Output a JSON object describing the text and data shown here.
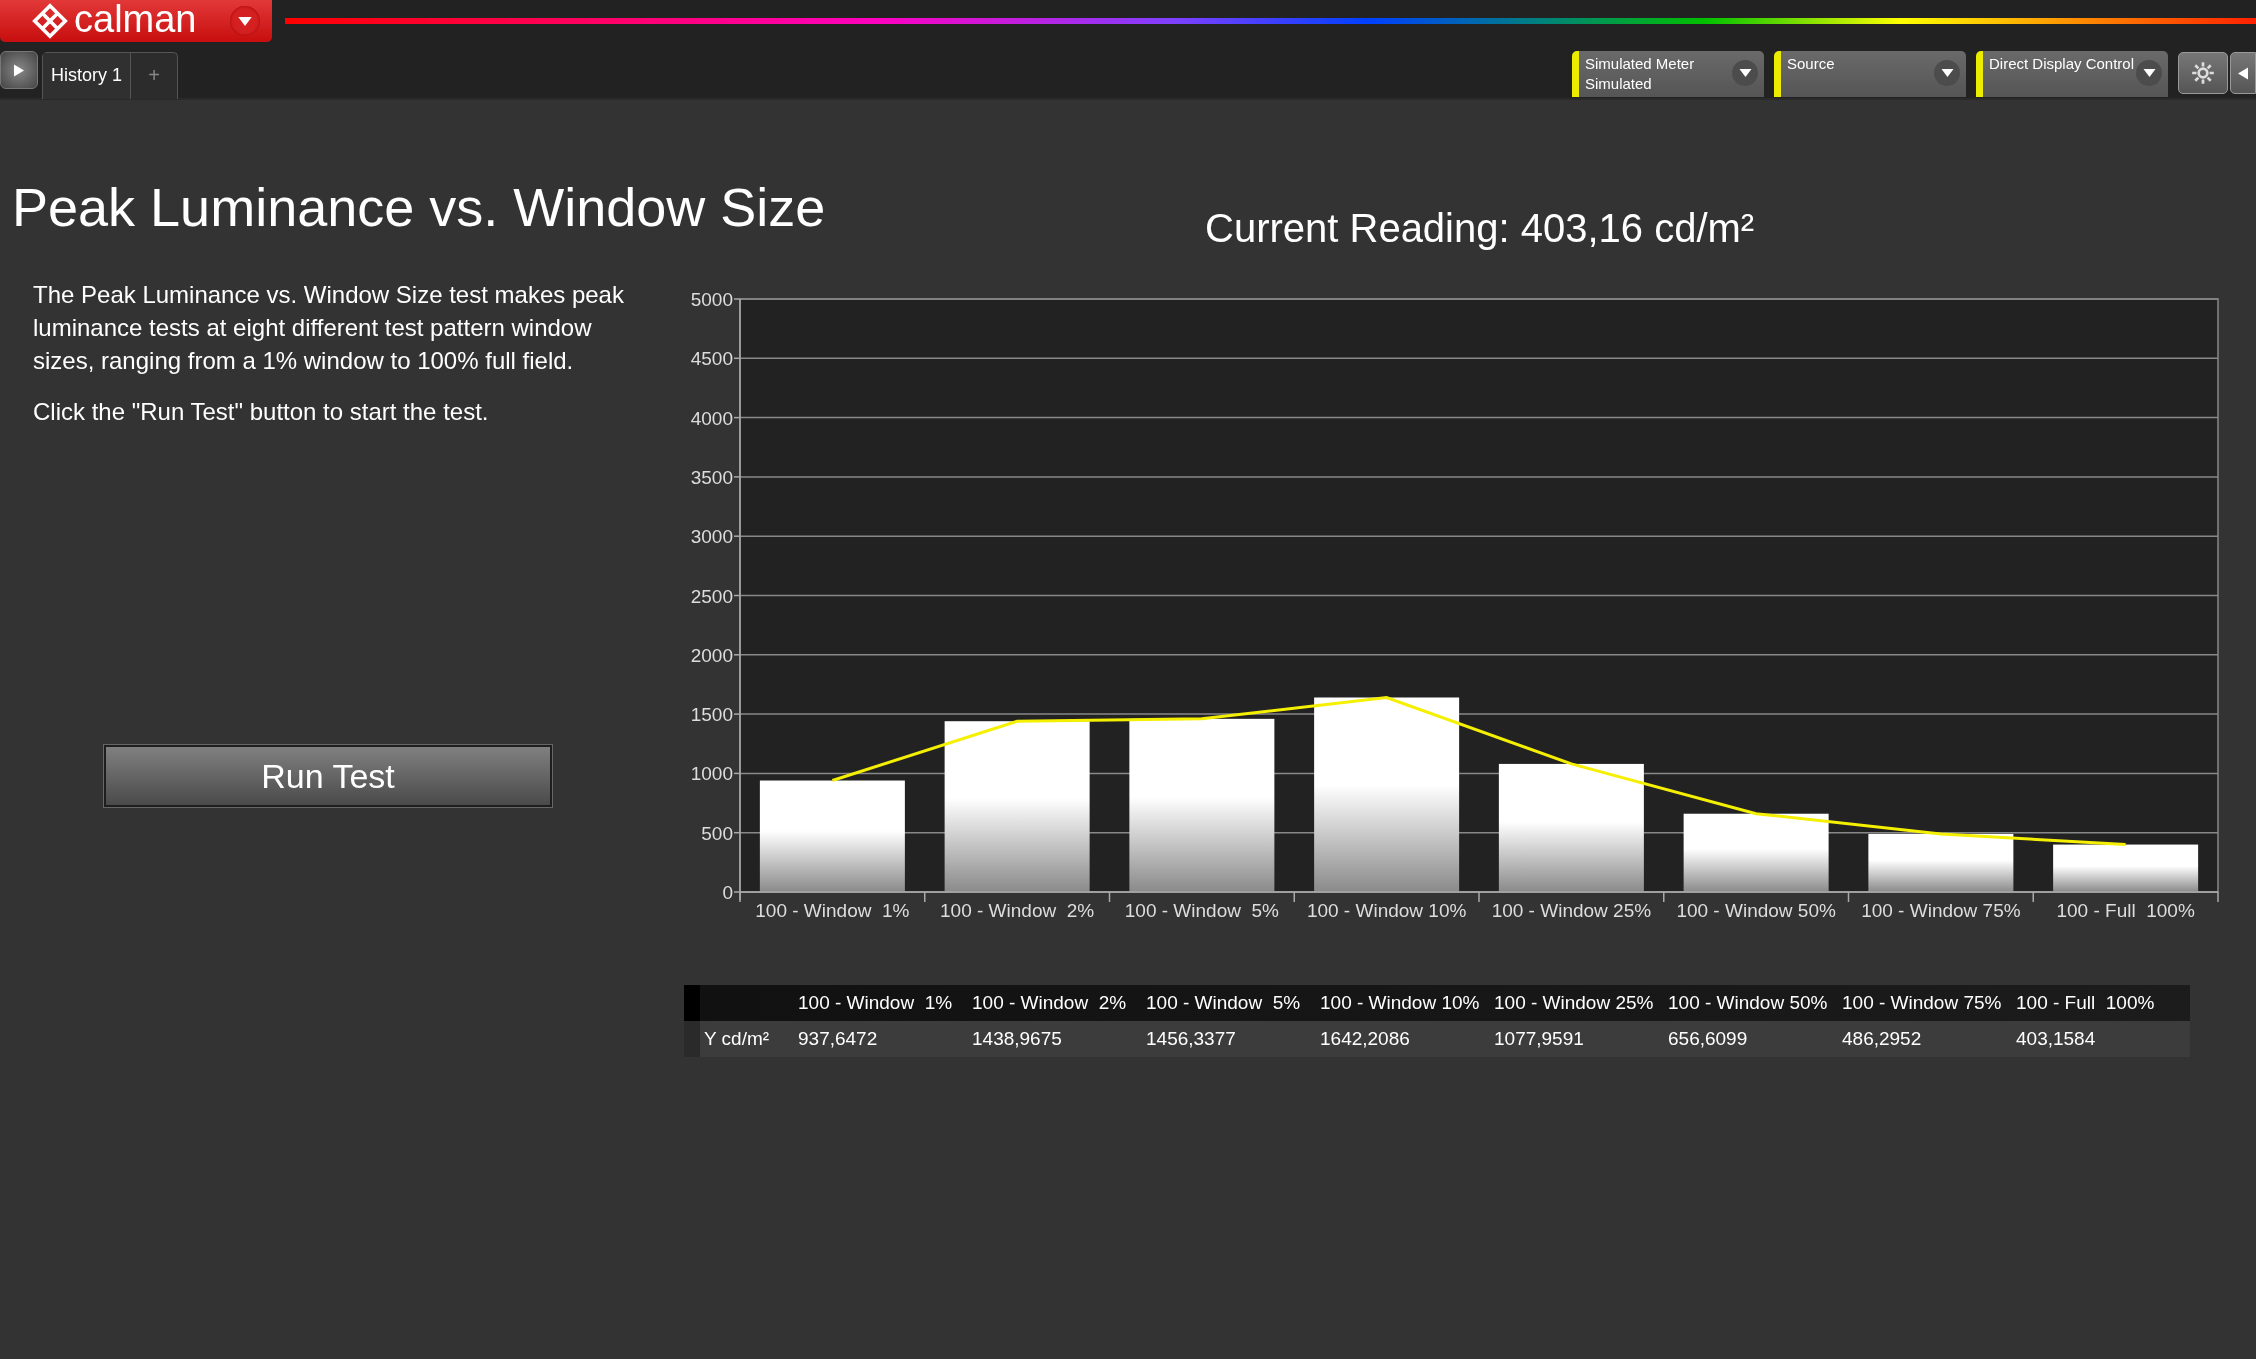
{
  "app": {
    "logo": "calman"
  },
  "tabs": [
    {
      "label": "History 1",
      "selected": true
    }
  ],
  "add_tab": "+",
  "dropdowns": [
    {
      "lines": [
        "Simulated Meter",
        "Simulated"
      ]
    },
    {
      "lines": [
        "Source"
      ]
    },
    {
      "lines": [
        "Direct Display Control"
      ]
    }
  ],
  "page": {
    "title": "Peak Luminance vs. Window Size",
    "description": [
      "The Peak Luminance vs. Window Size test makes peak luminance tests at eight different test pattern window sizes, ranging from a 1% window to 100% full field.",
      "Click the \"Run Test\" button to start the test."
    ],
    "run_button": "Run Test"
  },
  "chart": {
    "current_reading": "Current Reading: 403,16 cd/m²",
    "chart_data": {
      "type": "bar",
      "categories": [
        "100 - Window  1%",
        "100 - Window  2%",
        "100 - Window  5%",
        "100 - Window 10%",
        "100 - Window 25%",
        "100 - Window 50%",
        "100 - Window 75%",
        "100 - Full  100%"
      ],
      "series": [
        {
          "color": "#ffffff",
          "values": [
            940,
            1440,
            1460,
            1640,
            1080,
            660,
            490,
            400
          ]
        }
      ],
      "grid": true,
      "ylim": [
        0,
        5000
      ],
      "yticks": [
        0,
        500,
        1000,
        1500,
        2000,
        2500,
        3000,
        3500,
        4000,
        4500,
        5000
      ]
    }
  },
  "table": {
    "columns": [
      "100 - Window  1%",
      "100 - Window  2%",
      "100 - Window  5%",
      "100 - Window 10%",
      "100 - Window 25%",
      "100 - Window 50%",
      "100 - Window 75%",
      "100 - Full  100%"
    ],
    "rows": [
      {
        "label": "Y cd/m²",
        "values": [
          "937,6472",
          "1438,9675",
          "1456,3377",
          "1642,2086",
          "1077,9591",
          "656,6099",
          "486,2952",
          "403,1584"
        ]
      }
    ]
  }
}
